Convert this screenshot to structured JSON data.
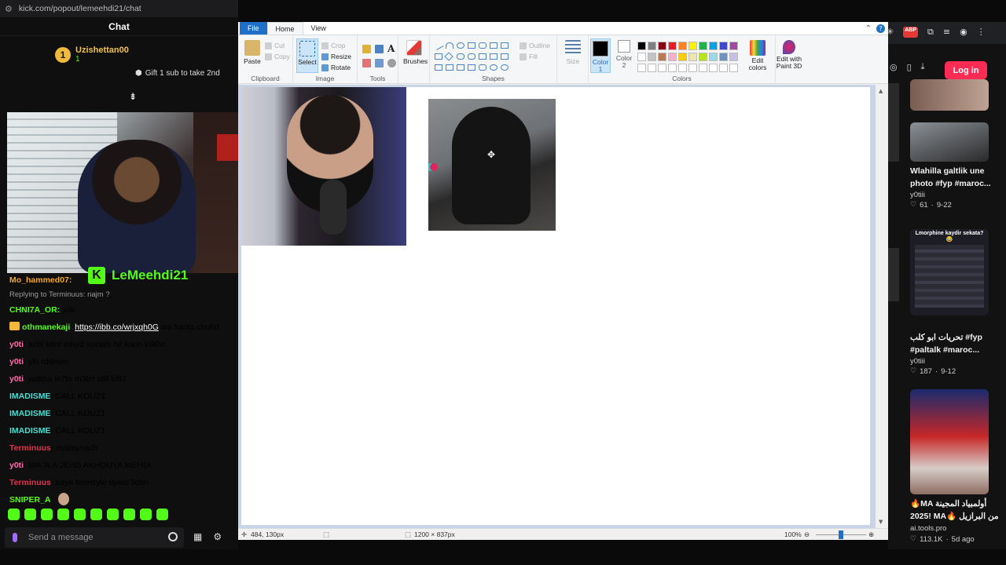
{
  "browser": {
    "url": "kick.com/popout/lemeehdi21/chat"
  },
  "chat": {
    "header": "Chat",
    "gifter": {
      "rank": "1",
      "username": "Uzishettan00",
      "sub_count": "1"
    },
    "gift_cta": "Gift 1 sub to take 2nd",
    "streamer": "LeMeehdi21",
    "messages": [
      {
        "user": "Mo_hammed07:",
        "color": "#f6a623",
        "text": ""
      },
      {
        "user": "CHNI7A_OR:",
        "color": "#53fc18",
        "text": "yoti",
        "reply": "Replying to Terminuus: najm ?"
      },
      {
        "user": "othmanekaji",
        "color": "#53fc18",
        "sep": ":",
        "link": "https://ibb.co/wrjxqh0G",
        "text": "wa hanta chofat",
        "crown": true
      },
      {
        "user": "y0ti",
        "color": "#ff6ba9",
        "sep": ":",
        "text": "azbi kent mhyd socials hit kano ki9lbo"
      },
      {
        "user": "y0ti",
        "color": "#ff6ba9",
        "sep": ":",
        "text": "ylh rdithom"
      },
      {
        "user": "y0ti",
        "color": "#ff6ba9",
        "sep": ":",
        "text": "wakha le7to m3tel still kitl3"
      },
      {
        "user": "IMADISME",
        "color": "#4bdcd0",
        "sep": ":",
        "text": "CALL KOUZ1"
      },
      {
        "user": "IMADISME",
        "color": "#4bdcd0",
        "sep": ":",
        "text": "CALL KOUZ1"
      },
      {
        "user": "IMADISME",
        "color": "#4bdcd0",
        "sep": ":",
        "text": "CALL KOUZ1"
      },
      {
        "user": "Terminuus",
        "color": "#e6304a",
        "sep": ":",
        "text": "makaynach"
      },
      {
        "user": "y0ti",
        "color": "#ff6ba9",
        "sep": ":",
        "text": "WA 3LA JEHD AKHOUYA MEHDI"
      },
      {
        "user": "Terminuus",
        "color": "#e6304a",
        "sep": ":",
        "text": "kayn freestyle dyalo 9dim"
      },
      {
        "user": "SNIPER_A",
        "color": "#53fc18",
        "sep": ":",
        "text": "",
        "emote": true
      }
    ],
    "input_placeholder": "Send a message"
  },
  "paint": {
    "tabs": [
      "File",
      "Home",
      "View"
    ],
    "clipboard": {
      "paste": "Paste",
      "cut": "Cut",
      "copy": "Copy",
      "label": "Clipboard"
    },
    "image": {
      "select": "Select",
      "crop": "Crop",
      "resize": "Resize",
      "rotate": "Rotate",
      "label": "Image"
    },
    "tools_label": "Tools",
    "brushes": "Brushes",
    "shapes": {
      "outline": "Outline",
      "fill": "Fill",
      "label": "Shapes"
    },
    "size": "Size",
    "color1": "Color 1",
    "color2": "Color 2",
    "colors_label": "Colors",
    "edit_colors": "Edit colors",
    "edit_3d": "Edit with Paint 3D",
    "palette_row1": [
      "#000000",
      "#7f7f7f",
      "#880015",
      "#ed1c24",
      "#ff7f27",
      "#fff200",
      "#22b14c",
      "#00a2e8",
      "#3f48cc",
      "#a349a4"
    ],
    "palette_row2": [
      "#ffffff",
      "#c3c3c3",
      "#b97a57",
      "#ffaec9",
      "#ffc90e",
      "#efe4b0",
      "#b5e61d",
      "#99d9ea",
      "#7092be",
      "#c8bfe7"
    ],
    "status": {
      "cursor": "484, 130px",
      "size": "1200 × 837px",
      "zoom": "100%"
    }
  },
  "tiktok": {
    "login": "Log in",
    "cards": [
      {
        "title": "Wlahilla galtlik une photo #fyp #maroc...",
        "user": "y0tiii",
        "likes": "61",
        "date": "9-22"
      },
      {
        "title": "تحريات ابو كلب #fyp #paltalk #maroc...",
        "user": "y0tiii",
        "likes": "187",
        "date": "9-12",
        "thumb_caption": "Lmorphine kaydir sekata? 😂"
      },
      {
        "title": "🔥MA أولمبياد المجينة 2025! MA🔥 من البرازيل",
        "user": "ai.tools.pro",
        "likes": "113.1K",
        "date": "5d ago"
      }
    ]
  }
}
